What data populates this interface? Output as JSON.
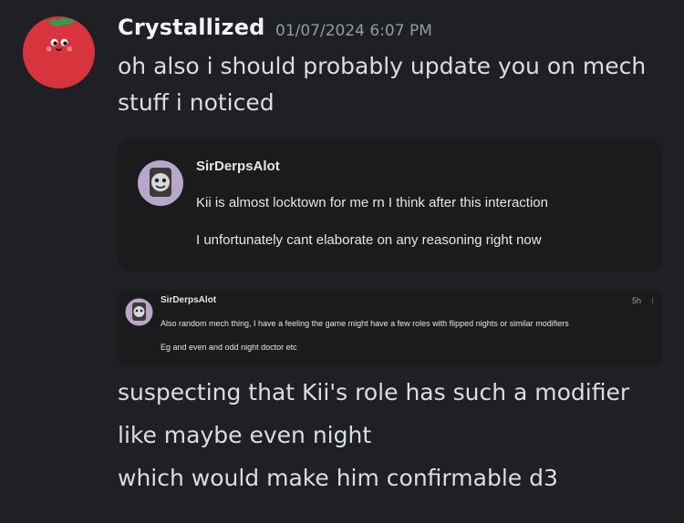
{
  "message": {
    "author": "Crystallized",
    "timestamp": "01/07/2024 6:07 PM",
    "lines_top": [
      "oh also i should probably update you on mech",
      "stuff i noticed"
    ],
    "lines_bottom": [
      "suspecting that Kii's role has such a modifier",
      "like maybe even night",
      "which would make him confirmable d3"
    ]
  },
  "embed1": {
    "author": "SirDerpsAlot",
    "lines": [
      "Kii is almost locktown for me rn I think after this interaction",
      "I unfortunately cant elaborate on any reasoning right now"
    ]
  },
  "embed2": {
    "author": "SirDerpsAlot",
    "time": "5h",
    "menu": "⁝",
    "lines": [
      "Also random mech thing, I have a feeling the game might have a few roles with flipped nights or similar modifiers",
      "Eg and even and odd night doctor etc"
    ]
  },
  "colors": {
    "background": "#1f2024",
    "card": "#1b1b1d",
    "avatar_red": "#d8343d",
    "leaf_green": "#2e9c52"
  }
}
